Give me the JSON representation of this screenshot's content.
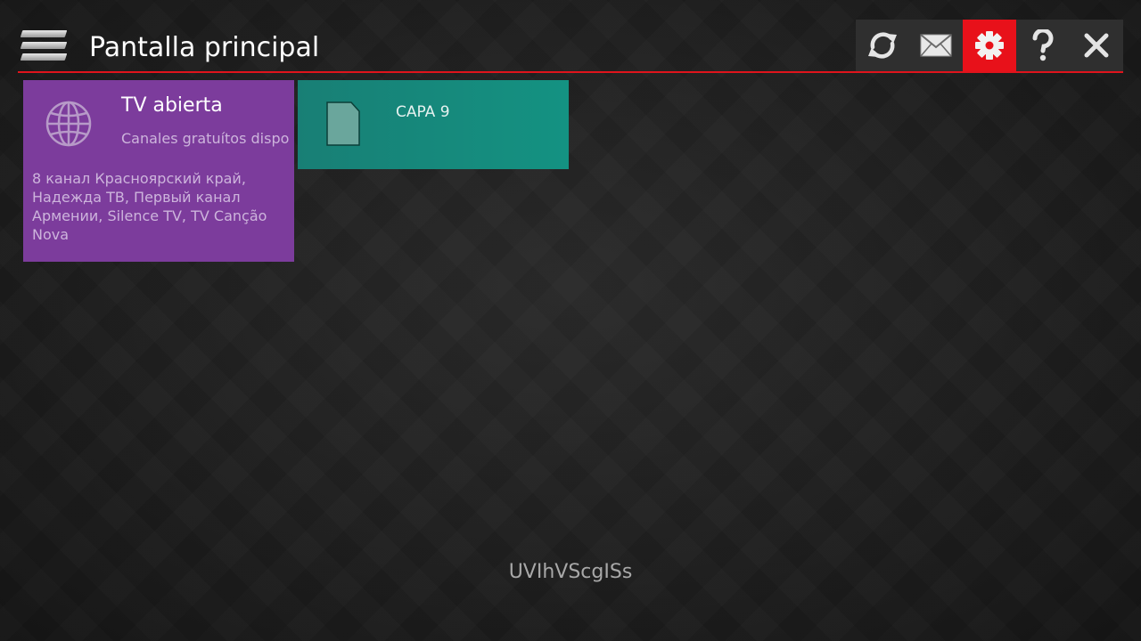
{
  "header": {
    "title": "Pantalla principal",
    "accent_color": "#e0141c",
    "toolbar": [
      {
        "name": "refresh-button",
        "icon": "refresh-icon",
        "active": false
      },
      {
        "name": "messages-button",
        "icon": "envelope-icon",
        "active": false
      },
      {
        "name": "settings-button",
        "icon": "gear-icon",
        "active": true
      },
      {
        "name": "help-button",
        "icon": "question-icon",
        "active": false
      },
      {
        "name": "close-button",
        "icon": "close-icon",
        "active": false
      }
    ]
  },
  "tiles": [
    {
      "icon": "globe-icon",
      "title": "TV abierta",
      "subtitle": "Canales gratuítos dispo",
      "description": "8 канал Красноярский край, Надежда ТВ, Первый канал Армении, Silence TV, TV Canção Nova",
      "color": "#7c3c9c"
    },
    {
      "icon": "sd-card-icon",
      "title": "CAPA 9",
      "color": "#149282"
    }
  ],
  "footer": {
    "code": "UVIhVScgISs"
  }
}
